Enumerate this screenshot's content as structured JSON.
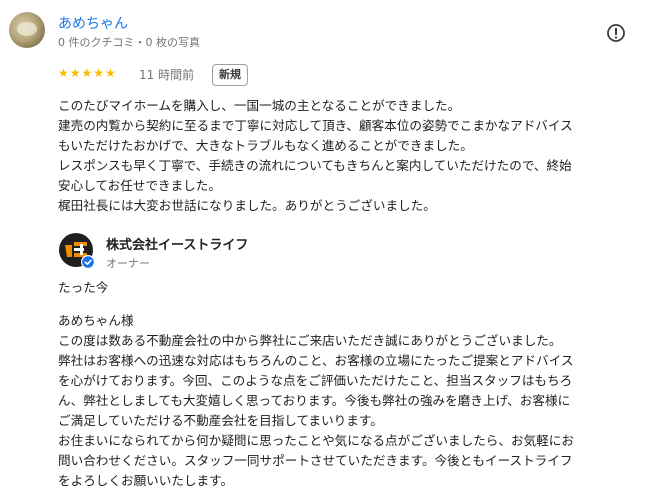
{
  "review": {
    "reviewer_name": "あめちゃん",
    "reviewer_stats": "0 件のクチコミ・0 枚の写真",
    "stars": "★★★★★",
    "rating": 5,
    "time": "11 時間前",
    "badge": "新規",
    "lines": [
      "このたびマイホームを購入し、一国一城の主となることができました。",
      "建売の内覧から契約に至るまで丁寧に対応して頂き、顧客本位の姿勢でこまかなアドバイス",
      "もいただけたおかげで、大きなトラブルもなく進めることができました。",
      "レスポンスも早く丁寧で、手続きの流れについてもきちんと案内していただけたので、終始",
      "安心してお任せできました。",
      "梶田社長には大変お世話になりました。ありがとうございました。"
    ]
  },
  "owner_reply": {
    "owner_name": "株式会社イーストライフ",
    "owner_role": "オーナー",
    "time": "たった今",
    "lines": [
      "あめちゃん様",
      "この度は数ある不動産会社の中から弊社にご来店いただき誠にありがとうございました。",
      "弊社はお客様への迅速な対応はもちろんのこと、お客様の立場にたったご提案とアドバイス",
      "を心がけております。今回、このような点をご評価いただけたこと、担当スタッフはもちろ",
      "ん、弊社としましても大変嬉しく思っております。今後も弊社の強みを磨き上げ、お客様に",
      "ご満足していただける不動産会社を目指してまいります。",
      "お住まいになられてから何か疑問に思ったことや気になる点がございましたら、お気軽にお",
      "問い合わせください。スタッフ一同サポートさせていただきます。今後ともイーストライフ",
      "をよろしくお願いいたします。"
    ]
  },
  "icons": {
    "report": "report-flag-icon",
    "verified": "verified-check-icon"
  },
  "colors": {
    "link": "#1a73e8",
    "star": "#fbbc04",
    "verified": "#1a73e8",
    "logo_orange": "#f08c00"
  }
}
